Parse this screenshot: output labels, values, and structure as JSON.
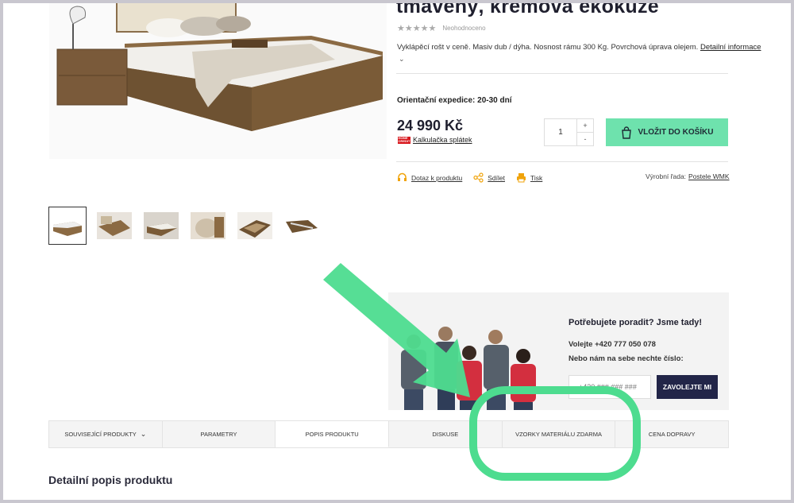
{
  "product": {
    "title": "tmavený, krémová ekokůže",
    "rating_text": "Neohodnoceno",
    "short_description": "Vyklápěcí rošt v ceně. Masiv dub / dýha. Nosnost rámu 300 Kg. Povrchová úprava olejem.",
    "detail_link": "Detailní informace",
    "expedition": "Orientační expedice: 20-30 dní",
    "price": "24 990 Kč",
    "calculator_link": "Kalkulačka splátek",
    "quantity": "1",
    "qty_plus": "+",
    "qty_minus": "-",
    "add_to_cart": "VLOŽIT DO KOŠÍKU"
  },
  "actions": {
    "inquiry": "Dotaz k produktu",
    "share": "Sdílet",
    "print": "Tisk",
    "series_label": "Výrobní řada:",
    "series_link": "Postele WMK"
  },
  "help": {
    "title": "Potřebujete poradit? Jsme tady!",
    "phone": "Volejte +420 777 050 078",
    "callback_text": "Nebo nám na sebe nechte číslo:",
    "phone_placeholder": "+420 ### ### ###",
    "call_me_button": "ZAVOLEJTE MI"
  },
  "tabs": [
    {
      "label": "SOUVISEJÍCÍ PRODUKTY"
    },
    {
      "label": "PARAMETRY"
    },
    {
      "label": "POPIS PRODUKTU"
    },
    {
      "label": "DISKUSE"
    },
    {
      "label": "VZORKY MATERIÁLU ZDARMA"
    },
    {
      "label": "CENA DOPRAVY"
    }
  ],
  "active_tab": "POPIS PRODUKTU",
  "detail_section_title": "Detailní popis produktu",
  "colors": {
    "accent_green": "#6ee2ad",
    "annotation_green": "#4ddc8f",
    "dark_navy": "#222548"
  },
  "icons": [
    "headset-icon",
    "share-icon",
    "printer-icon",
    "cart-bag-icon",
    "chevron-down-icon"
  ]
}
